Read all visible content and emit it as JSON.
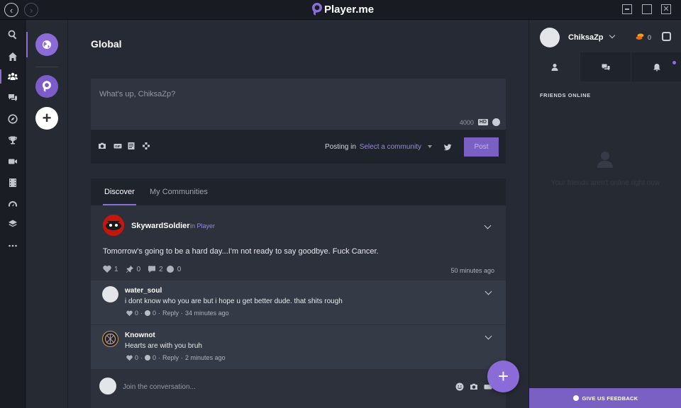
{
  "app": {
    "brand": "Player.me"
  },
  "nav_rail": {
    "items": [
      {
        "name": "search-icon"
      },
      {
        "name": "home-icon"
      },
      {
        "name": "communities-icon"
      },
      {
        "name": "chat-icon"
      },
      {
        "name": "compass-icon"
      },
      {
        "name": "trophy-icon"
      },
      {
        "name": "video-icon"
      },
      {
        "name": "film-icon"
      },
      {
        "name": "gauge-icon"
      },
      {
        "name": "layers-icon"
      },
      {
        "name": "more-icon"
      }
    ]
  },
  "main": {
    "title": "Global",
    "composer": {
      "placeholder": "What's up, ChiksaZp?",
      "char_count": "4000",
      "hd_label": "HD",
      "posting_label": "Posting in",
      "community_select": "Select a community",
      "post_button": "Post"
    },
    "tabs": [
      {
        "label": "Discover",
        "active": true
      },
      {
        "label": "My Communities",
        "active": false
      }
    ],
    "post": {
      "author": "SkywardSoldier",
      "in_label": "in",
      "community": "Player",
      "text": "Tomorrow's going to be a hard day...I'm not ready to say goodbye. Fuck Cancer.",
      "likes": "1",
      "shares": "0",
      "comments": "2",
      "coins": "0",
      "time": "50 minutes ago"
    },
    "comments": [
      {
        "author": "water_soul",
        "text": "i dont know who you are but i hope u get better dude. that shits rough",
        "likes": "0",
        "coins": "0",
        "reply": "Reply",
        "time": "34 minutes ago",
        "separator": "·"
      },
      {
        "author": "Knownot",
        "text": "Hearts are with you bruh",
        "likes": "0",
        "coins": "0",
        "reply": "Reply",
        "time": "2 minutes ago",
        "separator": "·"
      }
    ],
    "reply_placeholder": "Join the conversation...",
    "fab_label": "+"
  },
  "right_panel": {
    "username": "ChiksaZp",
    "coins": "0",
    "friends_heading": "FRIENDS ONLINE",
    "empty_text": "Your friends aren't online right now",
    "feedback": "GIVE US FEEDBACK"
  },
  "colors": {
    "accent": "#8b6fd6",
    "background": "#252a34",
    "post_button": "#7b60c4"
  }
}
